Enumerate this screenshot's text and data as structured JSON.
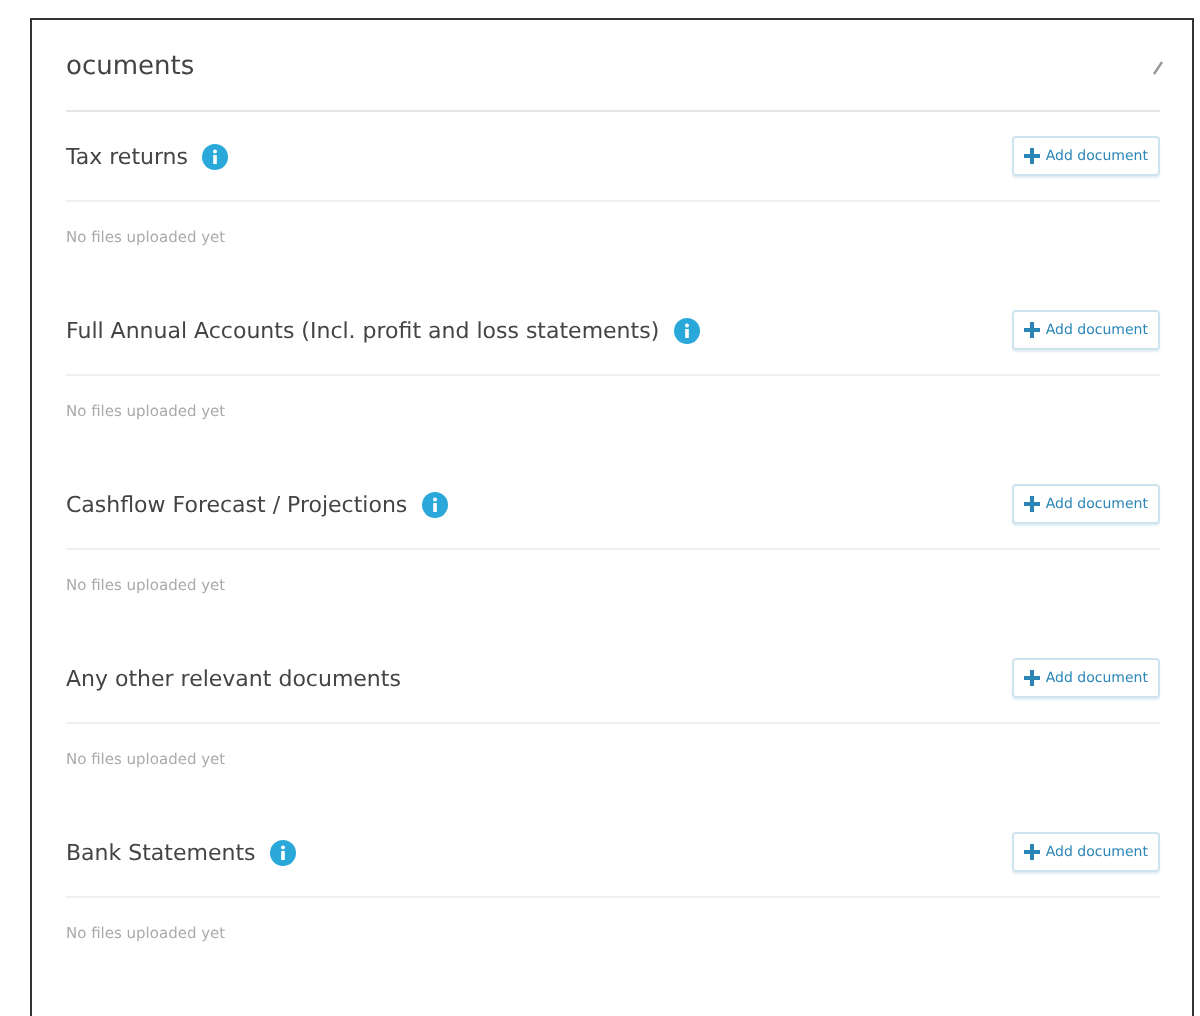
{
  "header": {
    "title": "ocuments"
  },
  "sections": [
    {
      "title": "Tax returns",
      "has_info": true,
      "button": "Add document",
      "status": "No files uploaded yet"
    },
    {
      "title": "Full Annual Accounts (Incl. profit and loss statements)",
      "has_info": true,
      "button": "Add document",
      "status": "No files uploaded yet"
    },
    {
      "title": "Cashflow Forecast / Projections",
      "has_info": true,
      "button": "Add document",
      "status": "No files uploaded yet"
    },
    {
      "title": "Any other relevant documents",
      "has_info": false,
      "button": "Add document",
      "status": "No files uploaded yet"
    },
    {
      "title": "Bank Statements",
      "has_info": true,
      "button": "Add document",
      "status": "No files uploaded yet"
    }
  ]
}
